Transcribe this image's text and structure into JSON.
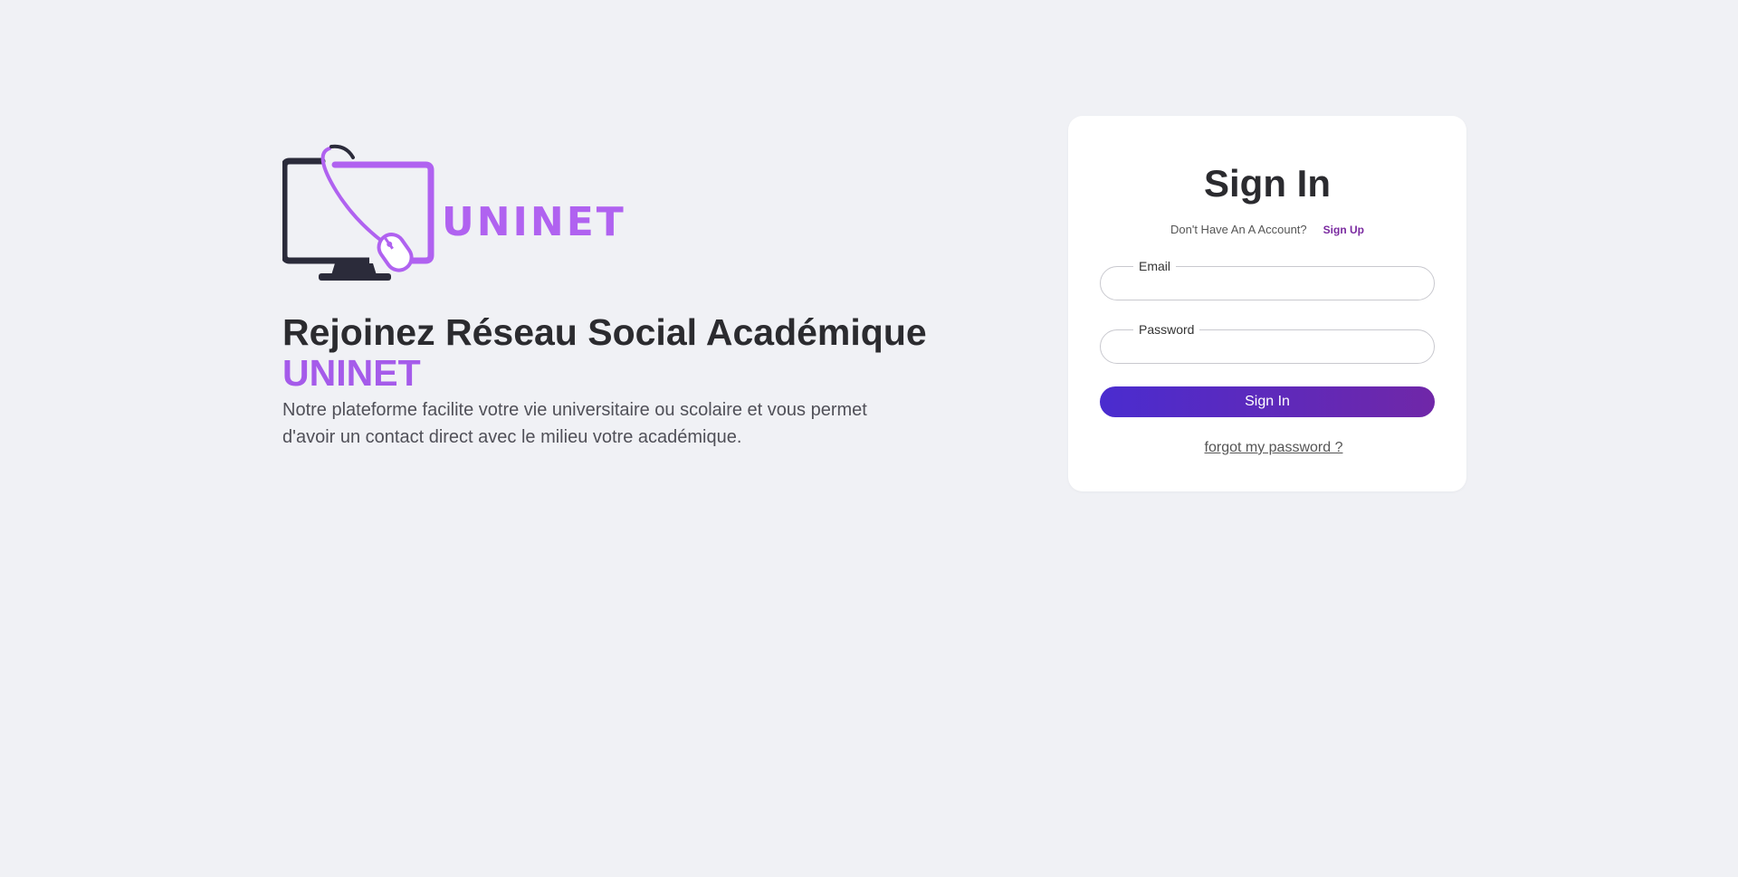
{
  "brand": {
    "logo_text": "UNINET",
    "accent_color": "#a55bea",
    "dark_color": "#2b2b2f"
  },
  "hero": {
    "title": "Rejoinez Réseau Social Académique",
    "brand_name": "UNINET",
    "description": "Notre plateforme facilite votre vie universitaire ou scolaire et vous permet d'avoir un contact direct avec le milieu votre académique."
  },
  "signin": {
    "title": "Sign In",
    "account_question": "Don't Have An A Account?",
    "signup_link": "Sign Up",
    "email_label": "Email",
    "email_value": "",
    "password_label": "Password",
    "password_value": "",
    "submit_label": "Sign In",
    "forgot_link": "forgot my password ?",
    "button_gradient": [
      "#4a2ccf",
      "#7027a8"
    ]
  },
  "icons": {
    "logo": "monitor-with-mouse-icon"
  }
}
